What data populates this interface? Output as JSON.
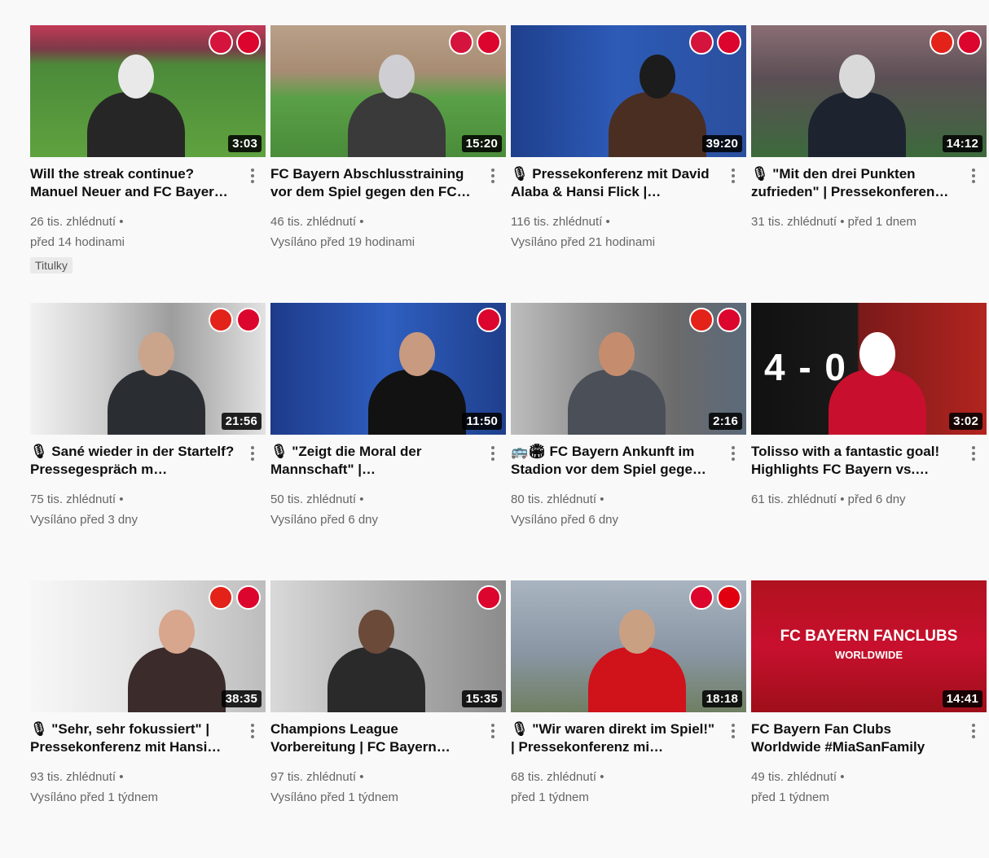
{
  "videos": [
    {
      "title": "Will the streak continue? Manuel Neuer and FC Bayer…",
      "duration": "3:03",
      "views": "26 tis. zhlédnutí •",
      "age": "před 14 hodinami",
      "badge": "Titulky",
      "thumb": {
        "bg": "linear-gradient(180deg,#c23a57 0%,#7c3a48 18%,#4c8a3a 30%,#5fa23f 100%)",
        "person": "#262626",
        "accent": "#e9e9e9",
        "logos": [
          "#d4143c",
          "#dc052d"
        ]
      }
    },
    {
      "title": "FC Bayern Abschlusstraining vor dem Spiel gegen den FC…",
      "duration": "15:20",
      "views": "46 tis. zhlédnutí •",
      "age": "Vysíláno před 19 hodinami",
      "thumb": {
        "bg": "linear-gradient(180deg,#b9a088 0%,#a88c74 35%,#5aa047 55%,#4a8c3a 100%)",
        "person": "#3a3a3a",
        "accent": "#cfcfd3",
        "logos": [
          "#d4143c",
          "#dc052d"
        ]
      }
    },
    {
      "title": "🎙 Pressekonferenz mit David Alaba & Hansi Flick |…",
      "duration": "39:20",
      "views": "116 tis. zhlédnutí •",
      "age": "Vysíláno před 21 hodinami",
      "thumb": {
        "bg": "linear-gradient(90deg,#1f3f8c 0%,#2d5bb7 45%,#2b4f9e 100%)",
        "person": "#4a2e22",
        "accent": "#1c1c1c",
        "logos": [
          "#d4143c",
          "#dc052d"
        ]
      }
    },
    {
      "title": "🎙 \"Mit den drei Punkten zufrieden\" | Pressekonferen…",
      "duration": "14:12",
      "views": "31 tis. zhlédnutí • před 1 dnem",
      "age": "",
      "thumb": {
        "bg": "linear-gradient(180deg,#8a6e74 0%,#5b4f55 40%,#3c6a3c 100%)",
        "person": "#1d2430",
        "accent": "#d9d9d9",
        "logos": [
          "#e32219",
          "#dc052d"
        ]
      }
    },
    {
      "title": "🎙 Sané wieder in der Startelf? Pressegespräch m…",
      "duration": "21:56",
      "views": "75 tis. zhlédnutí •",
      "age": "Vysíláno před 3 dny",
      "thumb": {
        "bg": "linear-gradient(90deg,#f2f2f2 0%,#cfcfcf 30%,#9d9d9d 60%,#e2e2e2 100%)",
        "person": "#2a2e33",
        "accent": "#cba48c",
        "logos": [
          "#e32219",
          "#dc052d"
        ]
      }
    },
    {
      "title": "🎙 \"Zeigt die Moral der Mannschaft\" |…",
      "duration": "11:50",
      "views": "50 tis. zhlédnutí •",
      "age": "Vysíláno před 6 dny",
      "thumb": {
        "bg": "linear-gradient(90deg,#1e3a8a 0%,#2f5fc0 50%,#1f3f8c 100%)",
        "person": "#121212",
        "accent": "#c89a80",
        "logos": [
          "#dc052d"
        ]
      }
    },
    {
      "title": "🚌🏟 FC Bayern Ankunft im Stadion vor dem Spiel gege…",
      "duration": "2:16",
      "views": "80 tis. zhlédnutí •",
      "age": "Vysíláno před 6 dny",
      "thumb": {
        "bg": "linear-gradient(90deg,#bdbdbd 0%,#8f8f8f 35%,#6b6b6b 70%,#5b6a7a 100%)",
        "person": "#4b4f57",
        "accent": "#c68c6e",
        "logos": [
          "#e32219",
          "#dc052d"
        ]
      }
    },
    {
      "title": "Tolisso with a fantastic goal! Highlights FC Bayern vs.…",
      "duration": "3:02",
      "views": "61 tis. zhlédnutí • před 6 dny",
      "age": "",
      "thumb": {
        "bg": "linear-gradient(90deg,#111 0%,#1a1a1a 45%,#7a1a1a 46%,#b3241f 100%)",
        "person": "#c8102e",
        "accent": "#ffffff",
        "logos": [],
        "score": "4 - 0"
      }
    },
    {
      "title": "🎙 \"Sehr, sehr fokussiert\" | Pressekonferenz mit Hansi…",
      "duration": "38:35",
      "views": "93 tis. zhlédnutí •",
      "age": "Vysíláno před 1 týdnem",
      "thumb": {
        "bg": "linear-gradient(90deg,#f7f7f7 0%,#e6e6e6 40%,#bdbdbd 100%)",
        "person": "#3b2b2b",
        "accent": "#d8a58d",
        "logos": [
          "#e32219",
          "#dc052d"
        ]
      }
    },
    {
      "title": "Champions League Vorbereitung | FC Bayern…",
      "duration": "15:35",
      "views": "97 tis. zhlédnutí •",
      "age": "Vysíláno před 1 týdnem",
      "thumb": {
        "bg": "linear-gradient(90deg,#d9d9d9 0%,#b8b8b8 40%,#8c8c8c 100%)",
        "person": "#2a2a2a",
        "accent": "#6b4a3a",
        "logos": [
          "#dc052d"
        ]
      }
    },
    {
      "title": "🎙 \"Wir waren direkt im Spiel!\" | Pressekonferenz mi…",
      "duration": "18:18",
      "views": "68 tis. zhlédnutí •",
      "age": "před 1 týdnem",
      "thumb": {
        "bg": "linear-gradient(180deg,#a9b4c0 0%,#8a96a4 55%,#6f7f62 100%)",
        "person": "#d0121b",
        "accent": "#caa083",
        "logos": [
          "#dc052d",
          "#e1000f"
        ]
      }
    },
    {
      "title": "FC Bayern Fan Clubs Worldwide #MiaSanFamily",
      "duration": "14:41",
      "views": "49 tis. zhlédnutí •",
      "age": "před 1 týdnem",
      "thumb": {
        "bg": "linear-gradient(180deg,#b0121e 0%,#c8102e 50%,#9e0f1a 100%)",
        "person": "",
        "accent": "#ffffff",
        "logos": [],
        "headline": "FC BAYERN FANCLUBS",
        "sub": "WORLDWIDE"
      }
    }
  ],
  "ui": {
    "menu_icon": "vertical-dots-icon"
  }
}
